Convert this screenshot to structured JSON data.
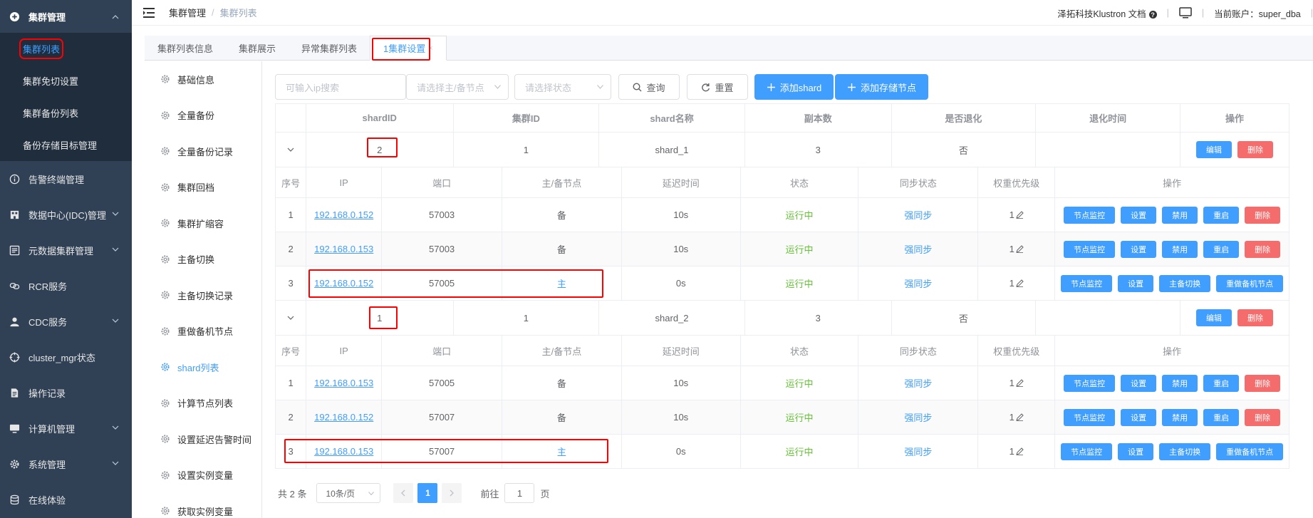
{
  "sidebar": {
    "groups": [
      {
        "label": "集群管理",
        "icon": "plus-circle-icon",
        "expanded": true,
        "items": [
          "集群列表",
          "集群免切设置",
          "集群备份列表",
          "备份存储目标管理"
        ]
      },
      {
        "label": "告警终端管理",
        "icon": "info-circle-icon"
      },
      {
        "label": "数据中心(IDC)管理",
        "icon": "building-icon"
      },
      {
        "label": "元数据集群管理",
        "icon": "list-box-icon"
      },
      {
        "label": "RCR服务",
        "icon": "link-icon"
      },
      {
        "label": "CDC服务",
        "icon": "user-icon"
      },
      {
        "label": "cluster_mgr状态",
        "icon": "crosshair-icon"
      },
      {
        "label": "操作记录",
        "icon": "document-icon"
      },
      {
        "label": "计算机管理",
        "icon": "monitor-icon"
      },
      {
        "label": "系统管理",
        "icon": "gear-icon"
      },
      {
        "label": "在线体验",
        "icon": "database-icon"
      }
    ]
  },
  "topbar": {
    "breadcrumb": [
      "集群管理",
      "集群列表"
    ],
    "docs_label": "泽拓科技Klustron 文档",
    "account_label": "当前账户：super_dba"
  },
  "tabs": [
    "集群列表信息",
    "集群展示",
    "异常集群列表",
    "1集群设置"
  ],
  "submenu": [
    "基础信息",
    "全量备份",
    "全量备份记录",
    "集群回档",
    "集群扩缩容",
    "主备切换",
    "主备切换记录",
    "重做备机节点",
    "shard列表",
    "计算节点列表",
    "设置延迟告警时间",
    "设置实例变量",
    "获取实例变量"
  ],
  "toolbar": {
    "ip_placeholder": "可输入ip搜索",
    "role_placeholder": "请选择主/备节点",
    "status_placeholder": "请选择状态",
    "query_label": "查询",
    "reset_label": "重置",
    "add_shard_label": "添加shard",
    "add_storage_label": "添加存储节点"
  },
  "table": {
    "headers": [
      "shardID",
      "集群ID",
      "shard名称",
      "副本数",
      "是否退化",
      "退化时间",
      "操作"
    ],
    "sub_headers": [
      "序号",
      "IP",
      "端口",
      "主/备节点",
      "延迟时间",
      "状态",
      "同步状态",
      "权重优先级",
      "操作"
    ],
    "edit_label": "编辑",
    "delete_label": "删除",
    "node_buttons": {
      "monitor": "节点监控",
      "settings": "设置",
      "disable": "禁用",
      "restart": "重启",
      "delete": "删除",
      "switch": "主备切换",
      "rebuild": "重做备机节点"
    },
    "shards": [
      {
        "shard_id": "2",
        "cluster_id": "1",
        "name": "shard_1",
        "replicas": "3",
        "degraded": "否",
        "degraded_time": "",
        "nodes": [
          {
            "seq": "1",
            "ip": "192.168.0.152",
            "port": "57003",
            "role": "备",
            "delay": "10s",
            "status": "运行中",
            "sync": "强同步",
            "weight": "1",
            "primary": false
          },
          {
            "seq": "2",
            "ip": "192.168.0.153",
            "port": "57003",
            "role": "备",
            "delay": "10s",
            "status": "运行中",
            "sync": "强同步",
            "weight": "1",
            "primary": false
          },
          {
            "seq": "3",
            "ip": "192.168.0.152",
            "port": "57005",
            "role": "主",
            "delay": "0s",
            "status": "运行中",
            "sync": "强同步",
            "weight": "1",
            "primary": true
          }
        ]
      },
      {
        "shard_id": "1",
        "cluster_id": "1",
        "name": "shard_2",
        "replicas": "3",
        "degraded": "否",
        "degraded_time": "",
        "nodes": [
          {
            "seq": "1",
            "ip": "192.168.0.153",
            "port": "57005",
            "role": "备",
            "delay": "10s",
            "status": "运行中",
            "sync": "强同步",
            "weight": "1",
            "primary": false
          },
          {
            "seq": "2",
            "ip": "192.168.0.152",
            "port": "57007",
            "role": "备",
            "delay": "10s",
            "status": "运行中",
            "sync": "强同步",
            "weight": "1",
            "primary": false
          },
          {
            "seq": "3",
            "ip": "192.168.0.153",
            "port": "57007",
            "role": "主",
            "delay": "0s",
            "status": "运行中",
            "sync": "强同步",
            "weight": "1",
            "primary": true
          }
        ]
      }
    ]
  },
  "pager": {
    "total_label": "共 2 条",
    "page_size": "10条/页",
    "current_page": "1",
    "goto_label": "前往",
    "goto_value": "1",
    "page_suffix": "页"
  },
  "colors": {
    "sidebar_bg": "#304156",
    "accent": "#409eff",
    "danger": "#f56c6c",
    "success": "#67c23a",
    "highlight": "#ff0000"
  }
}
